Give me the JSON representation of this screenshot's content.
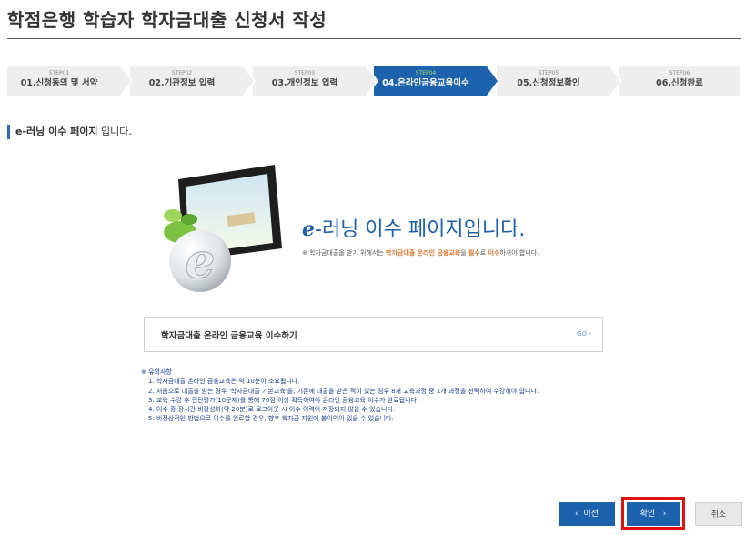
{
  "page": {
    "title": "학점은행 학습자 학자금대출 신청서 작성"
  },
  "steps": [
    {
      "num": "STEP01",
      "label": "01.신청동의 및 서약",
      "active": false
    },
    {
      "num": "STEP02",
      "label": "02.기관정보 입력",
      "active": false
    },
    {
      "num": "STEP03",
      "label": "03.개인정보 입력",
      "active": false
    },
    {
      "num": "STEP04",
      "label": "04.온라인금융교육이수",
      "active": true
    },
    {
      "num": "STEP05",
      "label": "05.신청정보확인",
      "active": false
    },
    {
      "num": "STEP06",
      "label": "06.신청완료",
      "active": false
    }
  ],
  "section": {
    "bold": "e-러닝 이수 페이지",
    "rest": " 입니다."
  },
  "promo": {
    "title_e": "e",
    "title_rest": "-러닝 이수 페이지입니다.",
    "sub_prefix": "※ 학자금대출을 받기 위해서는 ",
    "sub_hl1": "학자금대출 온라인 금융교육",
    "sub_mid": "을 ",
    "sub_hl2": "필수",
    "sub_mid2": "로 ",
    "sub_hl3": "이수",
    "sub_suffix": "하셔야 합니다."
  },
  "course": {
    "label": "학자금대출 온라인 금융교육 이수하기",
    "go": "GO ›"
  },
  "notes": {
    "heading": "※ 유의사항",
    "items": [
      "1. 학자금대출 온라인 금융교육은 약 10분이 소요됩니다.",
      "2. 처음으로 대출을 받는 경우 '학자금대출 기본교육'을, 기존에 대출을 받은 적이 있는 경우 8개 교육과정 중 1개 과정을 선택하여 수강해야 합니다.",
      "3. 교육 수강 후 진단평가(10문제)를 통해 70점 이상 획득하여야 온라인 금융교육 이수가 완료됩니다.",
      "4. 이수 중 장시간 비활성화(약 20분)로 로그아웃 시 이수 이력이 저장되지 않을 수 있습니다.",
      "5. 비정상적인 방법으로 이수를 완료할 경우, 향후 학자금 지원에 불이익이 있을 수 있습니다."
    ]
  },
  "buttons": {
    "prev": "이전",
    "prev_icon": "‹",
    "ok": "확인",
    "ok_icon": "›",
    "cancel": "취소"
  },
  "colors": {
    "accent": "#1d62ad",
    "highlight_frame": "#e01010",
    "step_active_num": "#9fe07a",
    "orange_highlight": "#d6742b"
  }
}
